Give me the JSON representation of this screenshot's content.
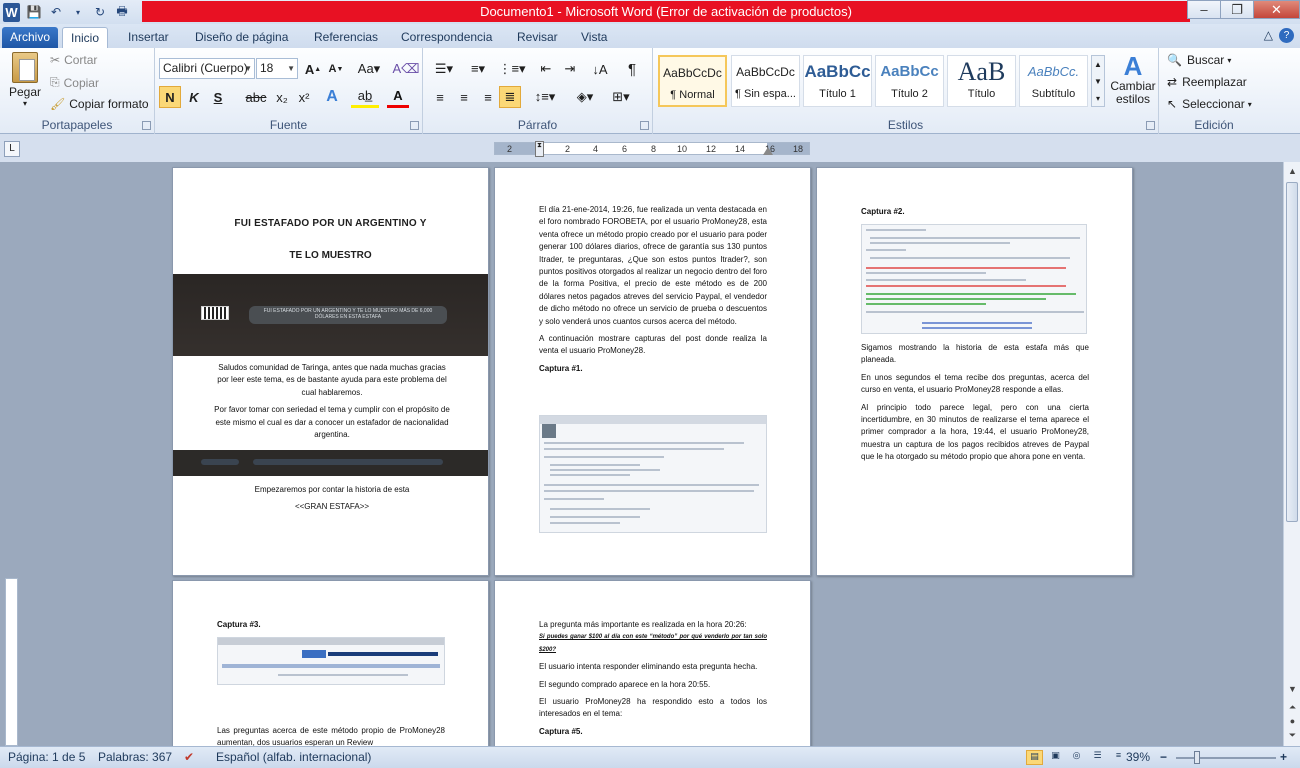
{
  "window": {
    "title": "Documento1  -  Microsoft Word (Error de activación de productos)"
  },
  "tabs": [
    "Archivo",
    "Inicio",
    "Insertar",
    "Diseño de página",
    "Referencias",
    "Correspondencia",
    "Revisar",
    "Vista"
  ],
  "clipboard": {
    "paste": "Pegar",
    "cut": "Cortar",
    "copy": "Copiar",
    "format_painter": "Copiar formato",
    "label": "Portapapeles"
  },
  "font": {
    "family": "Calibri (Cuerpo)",
    "size": "18",
    "label": "Fuente",
    "bold": "N",
    "italic": "K",
    "underline": "S",
    "strike": "abc"
  },
  "paragraph": {
    "label": "Párrafo"
  },
  "styles": {
    "label": "Estilos",
    "items": [
      {
        "preview": "AaBbCcDc",
        "name": "¶ Normal"
      },
      {
        "preview": "AaBbCcDc",
        "name": "¶ Sin espa..."
      },
      {
        "preview": "AaBbCc",
        "name": "Título 1"
      },
      {
        "preview": "AaBbCc",
        "name": "Título 2"
      },
      {
        "preview": "AaB",
        "name": "Título"
      },
      {
        "preview": "AaBbCc.",
        "name": "Subtítulo"
      }
    ],
    "change": "Cambiar estilos"
  },
  "editing": {
    "label": "Edición",
    "find": "Buscar",
    "replace": "Reemplazar",
    "select": "Seleccionar"
  },
  "ruler": {
    "ticks": [
      "2",
      "2",
      "4",
      "6",
      "8",
      "10",
      "12",
      "14",
      "16",
      "18"
    ]
  },
  "pages": {
    "p1": {
      "title1": "FUI ESTAFADO POR UN ARGENTINO Y",
      "title2": "TE LO MUESTRO",
      "banner": "FUI ESTAFADO POR UN ARGENTINO Y TE LO MUESTRO MÁS DE 6,000 DÓLARES EN ESTA ESTAFA",
      "para1": "Saludos comunidad de Taringa, antes que nada muchas gracias por leer este tema, es de bastante ayuda para este problema del cual hablaremos.",
      "para2": "Por favor tomar con seriedad el tema y cumplir con el propósito de este mismo el cual es dar a conocer un estafador de nacionalidad argentina.",
      "para3": "Empezaremos por contar la historia de esta",
      "para4": "<<GRAN ESTAFA>>"
    },
    "p2": {
      "para1": "El día 21-ene-2014, 19:26, fue realizada un venta destacada en el foro nombrado FOROBETA, por el usuario ProMoney28, esta venta ofrece un método propio creado por el usuario para poder generar 100 dólares diarios, ofrece de garantía sus 130 puntos Itrader, te preguntaras, ¿Que son estos puntos Itrader?, son puntos positivos otorgados al realizar un negocio dentro del foro de la forma Positiva, el precio de este método es de 200 dólares netos pagados atreves del servicio Paypal, el vendedor de dicho método no ofrece un servicio de prueba o descuentos y solo venderá unos cuantos cursos acerca del método.",
      "para2": "A continuación mostrare capturas del post donde realiza la venta el usuario ProMoney28.",
      "cap": "Captura #1."
    },
    "p3": {
      "cap": "Captura #2.",
      "para1": "Sigamos mostrando la historia de esta estafa más que planeada.",
      "para2": "En unos segundos el tema recibe dos preguntas, acerca del curso en venta, el usuario ProMoney28 responde a ellas.",
      "para3": "Al principio todo parece legal, pero con una cierta incertidumbre, en 30 minutos de realizarse el tema aparece el primer comprador a la hora, 19:44, el usuario ProMoney28, muestra un captura de los pagos recibidos atreves de Paypal que le ha otorgado su método propio que ahora pone en venta."
    },
    "p4": {
      "cap": "Captura #3.",
      "para1": "Las preguntas acerca de este método propio de ProMoney28 aumentan, dos usuarios esperan un Review"
    },
    "p5": {
      "para1": "La pregunta más importante es realizada en la hora 20:26:",
      "para1b": "Si puedes ganar $100 al día con este “método” por qué venderlo por tan solo $200?",
      "para2": "El usuario intenta responder eliminando esta pregunta hecha.",
      "para3": "El segundo comprado aparece en la hora 20:55.",
      "para4": "El usuario ProMoney28 ha respondido esto a todos los interesados en el tema:",
      "cap": "Captura #5."
    }
  },
  "status": {
    "page": "Página: 1 de 5",
    "words": "Palabras: 367",
    "lang": "Español (alfab. internacional)",
    "zoom": "39%"
  }
}
